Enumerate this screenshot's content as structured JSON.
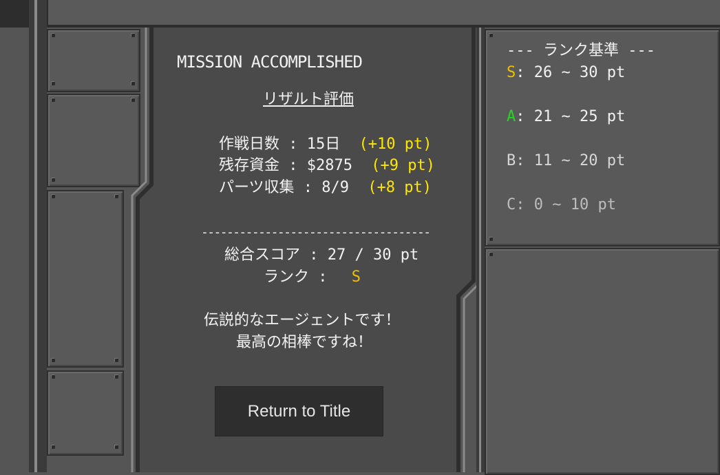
{
  "header": {
    "status_title": "MISSION ACCOMPLISHED",
    "result_title": "リザルト評価"
  },
  "results": [
    {
      "label": "作戦日数 : 15日",
      "bonus": "(+10 pt)"
    },
    {
      "label": "残存資金 : $2875",
      "bonus": "(+9 pt)"
    },
    {
      "label": "パーツ収集 : 8/9",
      "bonus": "(+8 pt)"
    }
  ],
  "separator": "------------------------------------",
  "total": {
    "label": "総合スコア : 27 / 30 pt",
    "rank_label": "ランク :",
    "rank_value": "S"
  },
  "message": {
    "line1": "伝説的なエージェントです！",
    "line2": "最高の相棒ですね！"
  },
  "button": {
    "label": "Return to Title"
  },
  "rank_criteria": {
    "title": "--- ランク基準 ---",
    "items": [
      {
        "rank": "S",
        "range": ": 26 ~ 30 pt",
        "color": "#f0c000"
      },
      {
        "rank": "A",
        "range": ": 21 ~ 25 pt",
        "color": "#26d626"
      },
      {
        "rank": "B",
        "range": ": 11 ~ 20 pt",
        "color": "#d7d7d7"
      },
      {
        "rank": "C",
        "range": ": 0 ~ 10 pt",
        "color": "#bdbdbd"
      }
    ]
  }
}
